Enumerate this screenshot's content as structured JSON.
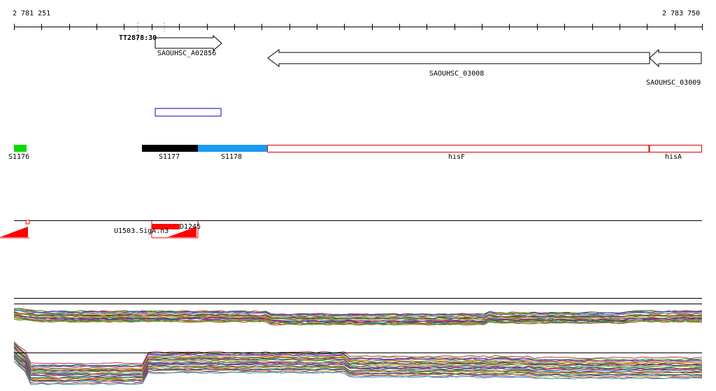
{
  "ruler": {
    "start_label": "2 781 251",
    "end_label": "2 783 750",
    "start": 2781251,
    "end": 2783750
  },
  "markers": {
    "tss_label": "TT2878:30"
  },
  "genes": [
    {
      "id": "SAOUHSC_A02856",
      "label": "SAOUHSC_A02856",
      "start": 2781752,
      "end": 2781993,
      "strand": "+"
    },
    {
      "id": "SAOUHSC_03008",
      "label": "SAOUHSC_03008",
      "start": 2782153,
      "end": 2783548,
      "strand": "-"
    },
    {
      "id": "SAOUHSC_03009",
      "label": "SAOUHSC_03009",
      "start": 2783548,
      "end": 2783750,
      "strand": "-"
    }
  ],
  "regions": [
    {
      "id": "S1176",
      "label": "S1176",
      "start": 2781251,
      "end": 2781297,
      "color": "#00dd00",
      "style": "filled"
    },
    {
      "id": "S1177",
      "label": "S1177",
      "start": 2781718,
      "end": 2781922,
      "color": "#000000",
      "style": "filled"
    },
    {
      "id": "S1178",
      "label": "S1178",
      "start": 2781922,
      "end": 2782153,
      "color": "#1a9af0",
      "style": "filled"
    },
    {
      "id": "hisF",
      "label": "hisF",
      "start": 2782153,
      "end": 2783548,
      "color": "#dd0000",
      "style": "outline"
    },
    {
      "id": "hisA",
      "label": "hisA",
      "start": 2783548,
      "end": 2783750,
      "color": "#dd0000",
      "style": "outline"
    }
  ],
  "signals": [
    {
      "id": "U1503",
      "label": "U1503.SigA.n3"
    },
    {
      "id": "D1245",
      "label": "D1245"
    }
  ],
  "colors": {
    "gene_outline": "#000000",
    "blue_box": "#0000cc",
    "signal": "#ff0000",
    "baseline": "#000000"
  }
}
